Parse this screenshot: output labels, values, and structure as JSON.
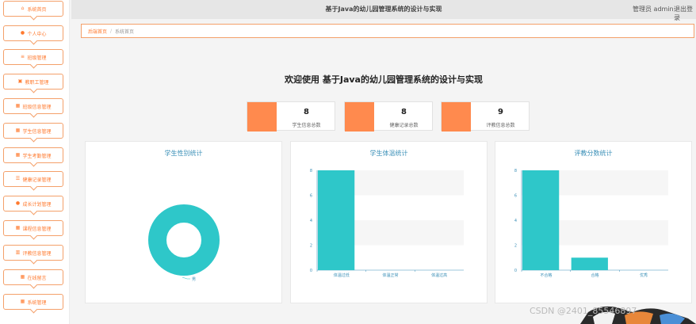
{
  "sidebar": {
    "items": [
      {
        "label": "系统首页",
        "icon": "home-icon",
        "glyph": "⌂"
      },
      {
        "label": "个人中心",
        "icon": "user-icon",
        "glyph": "●"
      },
      {
        "label": "班级管理",
        "icon": "list-icon",
        "glyph": "≡"
      },
      {
        "label": "教职工管理",
        "icon": "briefcase-icon",
        "glyph": "▣"
      },
      {
        "label": "班级信息管理",
        "icon": "grid-icon",
        "glyph": "▦"
      },
      {
        "label": "学生信息管理",
        "icon": "grid-icon",
        "glyph": "▦"
      },
      {
        "label": "学生考勤管理",
        "icon": "grid-icon",
        "glyph": "▦"
      },
      {
        "label": "健康记录管理",
        "icon": "sliders-icon",
        "glyph": "☰"
      },
      {
        "label": "成长计划管理",
        "icon": "user-icon",
        "glyph": "●"
      },
      {
        "label": "课程信息管理",
        "icon": "grid-icon",
        "glyph": "▦"
      },
      {
        "label": "评教信息管理",
        "icon": "bar-chart-icon",
        "glyph": "▥"
      },
      {
        "label": "在线留言",
        "icon": "grid-icon",
        "glyph": "▦"
      },
      {
        "label": "系统管理",
        "icon": "grid-icon",
        "glyph": "▦"
      }
    ]
  },
  "topbar": {
    "title": "基于Java的幼儿园管理系统的设计与实现",
    "user": "管理员 admin",
    "logout": "退出登录"
  },
  "breadcrumb": {
    "home": "后端首页",
    "separator": "/",
    "current": "系统首页"
  },
  "main": {
    "welcome": "欢迎使用 基于Java的幼儿园管理系统的设计与实现"
  },
  "stats": [
    {
      "value": "8",
      "label": "学生信息总数"
    },
    {
      "value": "8",
      "label": "健康记录总数"
    },
    {
      "value": "9",
      "label": "评教信息总数"
    }
  ],
  "colors": {
    "accent": "#ff7a2f",
    "stat_block": "#ff8a4e",
    "chart": "#2ec7c9",
    "chart_title": "#3a8fb7"
  },
  "chart_data": [
    {
      "type": "pie",
      "title": "学生性别统计",
      "categories": [
        "男"
      ],
      "values": [
        8
      ]
    },
    {
      "type": "bar",
      "title": "学生体温统计",
      "categories": [
        "体温过低",
        "体温正常",
        "体温过高"
      ],
      "values": [
        8,
        0,
        0
      ],
      "ylim": [
        0,
        8
      ],
      "yticks": [
        "0",
        "2",
        "4",
        "6",
        "8"
      ]
    },
    {
      "type": "bar",
      "title": "评教分数统计",
      "categories": [
        "不合格",
        "合格",
        "优秀"
      ],
      "values": [
        8,
        1,
        0
      ],
      "ylim": [
        0,
        8
      ],
      "yticks": [
        "0",
        "2",
        "4",
        "6",
        "8"
      ]
    }
  ],
  "watermark": "CSDN @2401_85546897"
}
